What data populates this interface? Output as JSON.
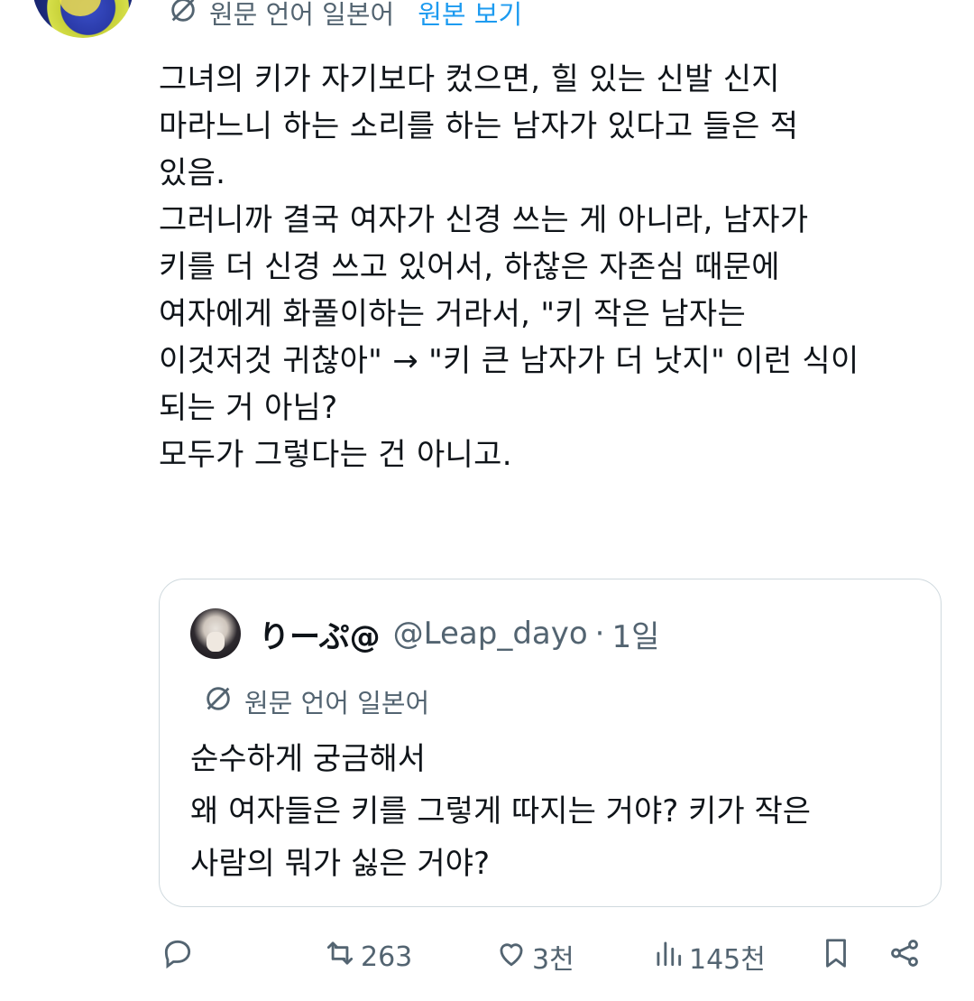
{
  "tweet": {
    "translation": {
      "label": "원문 언어 일본어",
      "view_original": "원본 보기"
    },
    "text": "그녀의 키가 자기보다 컸으면, 힐 있는 신발 신지\n마라느니 하는 소리를 하는 남자가 있다고 들은 적\n있음.\n그러니까 결국 여자가 신경 쓰는 게 아니라, 남자가\n키를 더 신경 쓰고 있어서, 하찮은 자존심 때문에\n여자에게 화풀이하는 거라서, \"키 작은 남자는\n이것저것 귀찮아\" → \"키 큰 남자가 더 낫지\" 이런 식이\n되는 거 아님?\n모두가 그렇다는 건 아니고."
  },
  "quote": {
    "name": "りーぷ@",
    "handle": "@Leap_dayo",
    "separator": "·",
    "time": "1일",
    "translation_label": "원문 언어 일본어",
    "text": "순수하게 궁금해서\n왜 여자들은 키를 그렇게 따지는 거야? 키가 작은\n사람의 뭐가 싫은 거야?"
  },
  "actions": {
    "reply_icon": "reply-icon",
    "retweet": {
      "icon": "retweet-icon",
      "count": "263"
    },
    "like": {
      "icon": "heart-icon",
      "count": "3천"
    },
    "views": {
      "icon": "views-icon",
      "count": "145천"
    },
    "bookmark_icon": "bookmark-icon",
    "share_icon": "share-icon"
  },
  "colors": {
    "text": "#0f1419",
    "secondary": "#536471",
    "link": "#1d9bf0",
    "border": "#cfd9de"
  }
}
